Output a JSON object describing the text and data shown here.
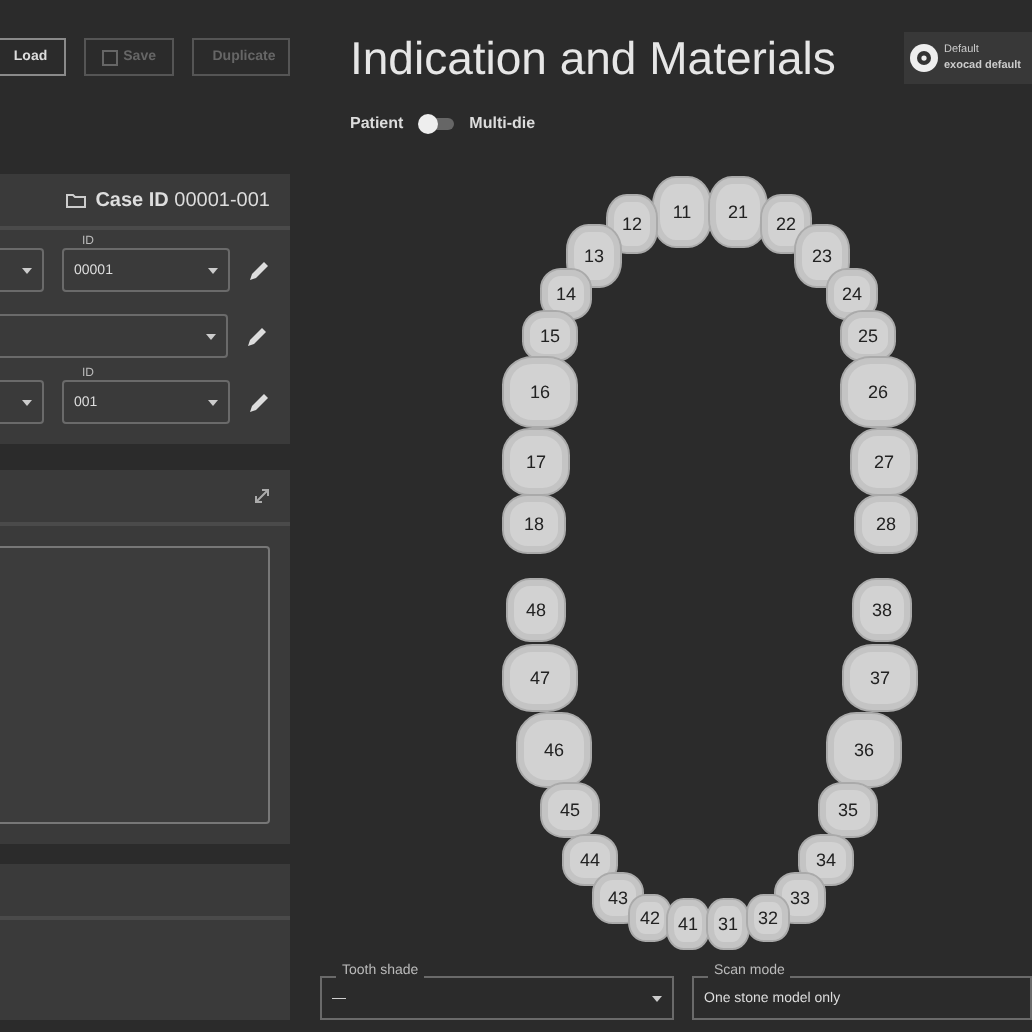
{
  "toolbar": {
    "buttons": [
      {
        "label": "Load",
        "disabled": false
      },
      {
        "label": "Save",
        "disabled": true
      },
      {
        "label": "Duplicate",
        "disabled": true
      }
    ]
  },
  "case_panel": {
    "case_id_label": "Case ID",
    "case_id": "00001-001",
    "rows": [
      {
        "fields": [
          {
            "kind": "dropdown"
          },
          {
            "kind": "dropdown",
            "label": "ID",
            "value": "00001"
          }
        ]
      },
      {
        "fields": [
          {
            "kind": "dropdown"
          }
        ]
      },
      {
        "fields": [
          {
            "kind": "dropdown"
          },
          {
            "kind": "dropdown",
            "label": "ID",
            "value": "001"
          }
        ]
      }
    ]
  },
  "title": "Indication and Materials",
  "profile": {
    "name": "Default",
    "subtitle": "exocad default"
  },
  "mode_switch": {
    "left_label": "Patient",
    "right_label": "Multi-die",
    "on": false
  },
  "teeth": [
    "11",
    "21",
    "12",
    "22",
    "13",
    "23",
    "14",
    "24",
    "15",
    "25",
    "16",
    "26",
    "17",
    "27",
    "18",
    "28",
    "48",
    "38",
    "47",
    "37",
    "46",
    "36",
    "45",
    "35",
    "44",
    "34",
    "43",
    "33",
    "42",
    "41",
    "31",
    "32"
  ],
  "bottom_fields": [
    {
      "label": "Tooth shade",
      "value": "—",
      "dropdown": true
    },
    {
      "label": "Scan mode",
      "value": "One stone model only",
      "dropdown": false
    }
  ]
}
